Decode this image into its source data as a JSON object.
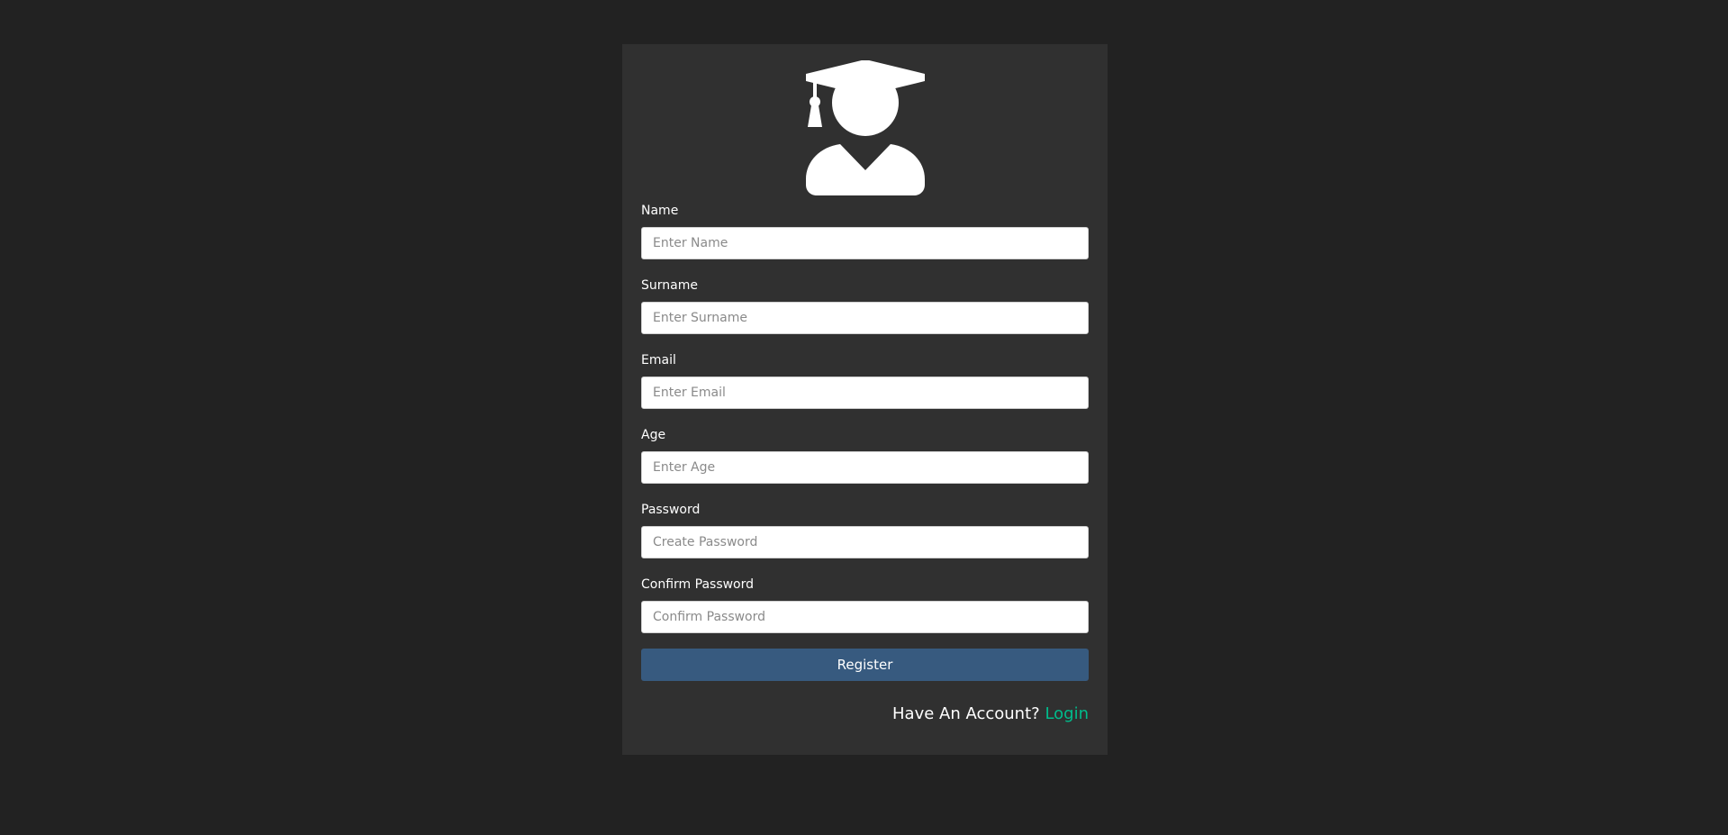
{
  "colors": {
    "page_background": "#222222",
    "card_background": "#303030",
    "button_background": "#375a7f",
    "link_color": "#00bc8c"
  },
  "logo": {
    "icon": "graduate-user-icon"
  },
  "form": {
    "fields": [
      {
        "label": "Name",
        "placeholder": "Enter Name",
        "value": ""
      },
      {
        "label": "Surname",
        "placeholder": "Enter Surname",
        "value": ""
      },
      {
        "label": "Email",
        "placeholder": "Enter Email",
        "value": ""
      },
      {
        "label": "Age",
        "placeholder": "Enter Age",
        "value": ""
      },
      {
        "label": "Password",
        "placeholder": "Create Password",
        "value": ""
      },
      {
        "label": "Confirm Password",
        "placeholder": "Confirm Password",
        "value": ""
      }
    ],
    "submit_label": "Register"
  },
  "footer": {
    "prompt": "Have An Account?",
    "link_label": "Login"
  }
}
